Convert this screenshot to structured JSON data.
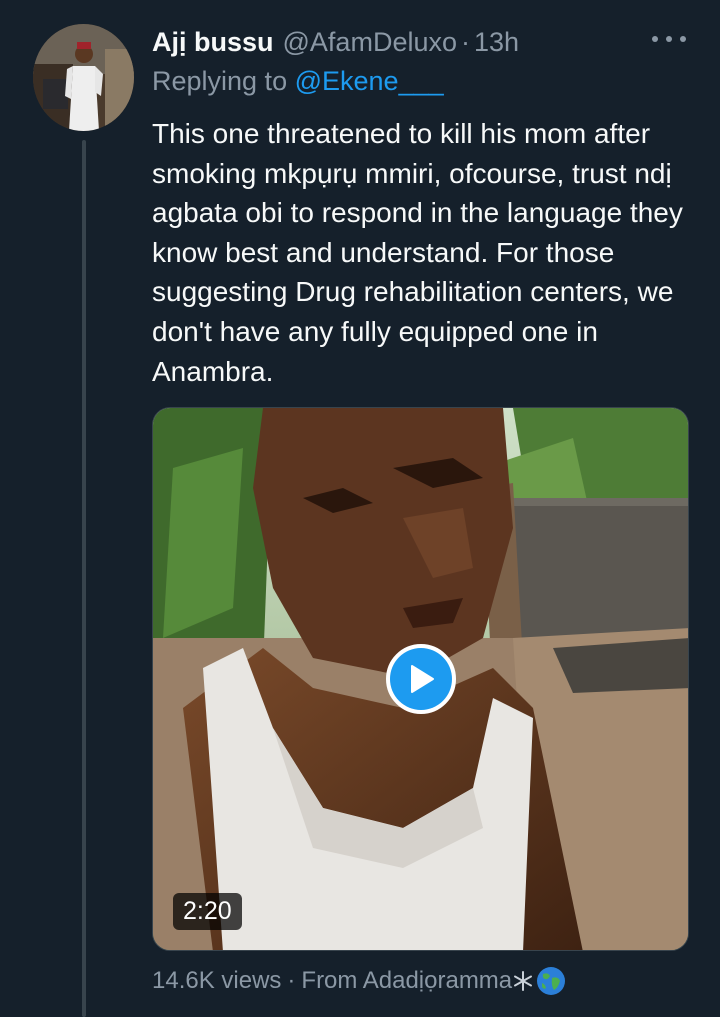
{
  "tweet": {
    "author": {
      "display_name": "Ajị bussu",
      "handle": "@AfamDeluxo",
      "separator": "·",
      "time": "13h"
    },
    "reply": {
      "prefix": "Replying to",
      "handle": "@Ekene___"
    },
    "text": "This one threatened to kill his mom after smoking mkpụrụ mmiri, ofcourse, trust ndị agbata obi to respond in the language they know best and understand. For those suggesting Drug rehabilitation centers, we don't have any fully equipped one in Anambra.",
    "media": {
      "type": "video",
      "duration": "2:20",
      "icon": "play-icon"
    },
    "footer": {
      "views": "14.6K views",
      "separator": "·",
      "source": "From Adadịọramma"
    }
  },
  "icons": {
    "more": "more-horizontal-icon",
    "snowflake": "snowflake-icon",
    "globe": "globe-icon"
  },
  "colors": {
    "background": "#15202b",
    "accent": "#1d9bf0",
    "secondary_text": "#8b98a5",
    "primary_text": "#f7f9f9"
  }
}
